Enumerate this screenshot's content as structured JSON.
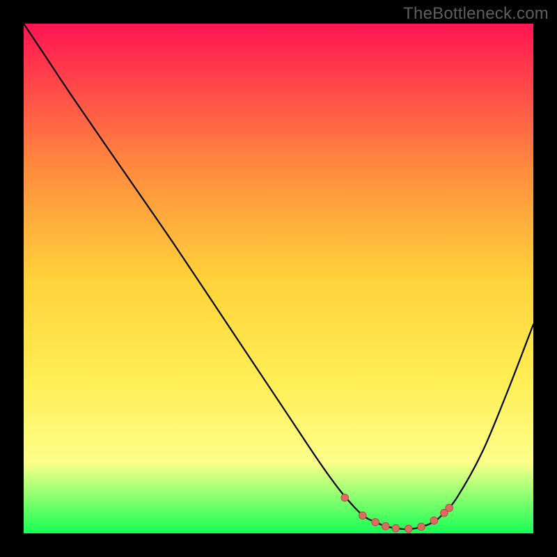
{
  "watermark": "TheBottleneck.com",
  "colors": {
    "frame_bg": "#000000",
    "gradient_top": "#ff1452",
    "gradient_mid_upper": "#ff8a3e",
    "gradient_mid": "#ffd23a",
    "gradient_mid_lower": "#ffee55",
    "gradient_lower": "#fdff8a",
    "gradient_bottom": "#15ff55",
    "curve": "#000000",
    "marker_fill": "#d96d63",
    "marker_stroke": "#b84a42"
  },
  "chart_data": {
    "type": "line",
    "title": "",
    "xlabel": "",
    "ylabel": "",
    "xlim": [
      0,
      100
    ],
    "ylim": [
      0,
      100
    ],
    "grid": false,
    "legend": null,
    "series": [
      {
        "name": "bottleneck-curve",
        "x": [
          0,
          4,
          10,
          20,
          30,
          40,
          50,
          58,
          62,
          65,
          67,
          69,
          71,
          73,
          75,
          77,
          80,
          82,
          85,
          90,
          95,
          100
        ],
        "y": [
          100,
          94,
          85,
          70.5,
          56,
          41,
          26,
          14,
          8.5,
          5,
          3.2,
          2.2,
          1.4,
          1.0,
          0.8,
          1.0,
          2.0,
          3.5,
          7,
          16,
          28,
          41
        ]
      }
    ],
    "markers": [
      {
        "x": 63.0,
        "y": 7.0
      },
      {
        "x": 66.5,
        "y": 3.5
      },
      {
        "x": 69.0,
        "y": 2.2
      },
      {
        "x": 71.0,
        "y": 1.4
      },
      {
        "x": 73.0,
        "y": 1.0
      },
      {
        "x": 75.5,
        "y": 0.9
      },
      {
        "x": 78.0,
        "y": 1.3
      },
      {
        "x": 80.5,
        "y": 2.5
      },
      {
        "x": 82.5,
        "y": 4.0
      },
      {
        "x": 83.5,
        "y": 5.0
      }
    ],
    "annotations": []
  }
}
